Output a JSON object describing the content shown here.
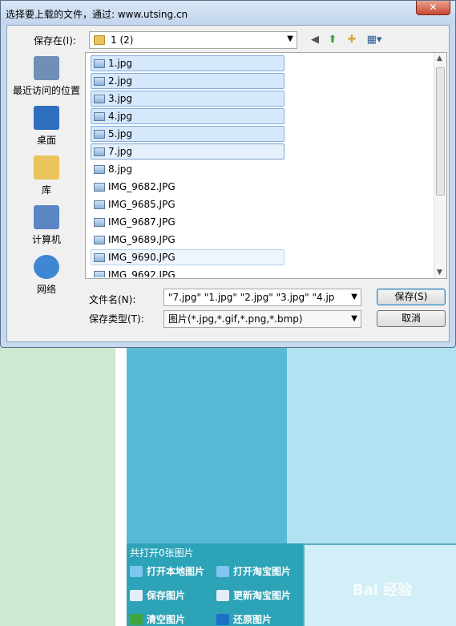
{
  "dialog": {
    "title": "选择要上载的文件，通过: www.utsing.cn",
    "close_glyph": "✕",
    "save_in_label": "保存在(I):",
    "save_in_value": "1 (2)",
    "places": [
      {
        "label": "最近访问的位置",
        "icon": "recent-places-icon",
        "color": "#6f8fb6"
      },
      {
        "label": "桌面",
        "icon": "desktop-icon",
        "color": "#2f6fbf"
      },
      {
        "label": "库",
        "icon": "libraries-icon",
        "color": "#e9c35c"
      },
      {
        "label": "计算机",
        "icon": "computer-icon",
        "color": "#5a86c4"
      },
      {
        "label": "网络",
        "icon": "network-icon",
        "color": "#3f86d3"
      }
    ],
    "files": [
      {
        "name": "1.jpg",
        "state": "sel"
      },
      {
        "name": "2.jpg",
        "state": "sel"
      },
      {
        "name": "3.jpg",
        "state": "sel"
      },
      {
        "name": "4.jpg",
        "state": "sel"
      },
      {
        "name": "5.jpg",
        "state": "sel"
      },
      {
        "name": "7.jpg",
        "state": "focus"
      },
      {
        "name": "8.jpg",
        "state": ""
      },
      {
        "name": "IMG_9682.JPG",
        "state": ""
      },
      {
        "name": "IMG_9685.JPG",
        "state": ""
      },
      {
        "name": "IMG_9687.JPG",
        "state": ""
      },
      {
        "name": "IMG_9689.JPG",
        "state": ""
      },
      {
        "name": "IMG_9690.JPG",
        "state": "hover"
      },
      {
        "name": "IMG_9692.JPG",
        "state": ""
      }
    ],
    "filename_label": "文件名(N):",
    "filename_value": "\"7.jpg\" \"1.jpg\" \"2.jpg\" \"3.jpg\" \"4.jp",
    "filetype_label": "保存类型(T):",
    "filetype_value": "图片(*.jpg,*.gif,*.png,*.bmp)",
    "save_button": "保存(S)",
    "cancel_button": "取消"
  },
  "background": {
    "count_text": "共打开0张图片",
    "buttons": {
      "open_local": "打开本地图片",
      "open_taobao": "打开淘宝图片",
      "save_image": "保存图片",
      "update_taobao": "更新淘宝图片",
      "clear_image": "清空图片",
      "restore_image": "还原图片"
    },
    "watermark": "Bai 经验"
  }
}
